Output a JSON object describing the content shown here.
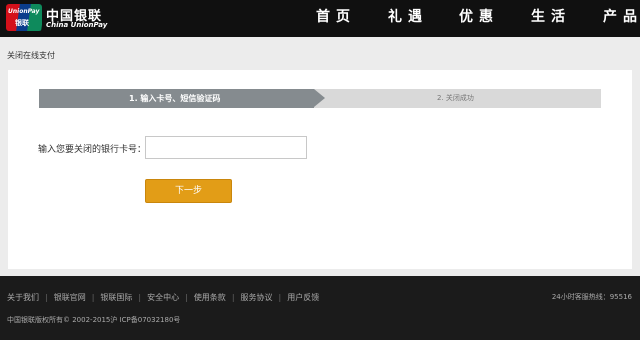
{
  "header": {
    "logo": {
      "card_top": "UnionPay",
      "card_bottom": "银联",
      "cn": "中国银联",
      "en": "China UnionPay"
    },
    "nav": [
      "首页",
      "礼遇",
      "优惠",
      "生活",
      "产品"
    ]
  },
  "breadcrumb": "关闭在线支付",
  "steps": {
    "active": "1. 输入卡号、短信验证码",
    "next": "2. 关闭成功"
  },
  "form": {
    "card_label": "输入您要关闭的银行卡号：",
    "card_value": "",
    "next_button": "下一步"
  },
  "footer": {
    "links": [
      "关于我们",
      "银联官网",
      "银联国际",
      "安全中心",
      "使用条款",
      "服务协议",
      "用户反馈"
    ],
    "hotline": "24小时客服热线：95516",
    "copyright": "中国银联版权所有©  2002-2015沪  ICP备07032180号"
  },
  "colors": {
    "header_bg": "#101010",
    "step_active": "#858b8f",
    "button": "#e29d17",
    "footer_bg": "#1b1b1b"
  }
}
